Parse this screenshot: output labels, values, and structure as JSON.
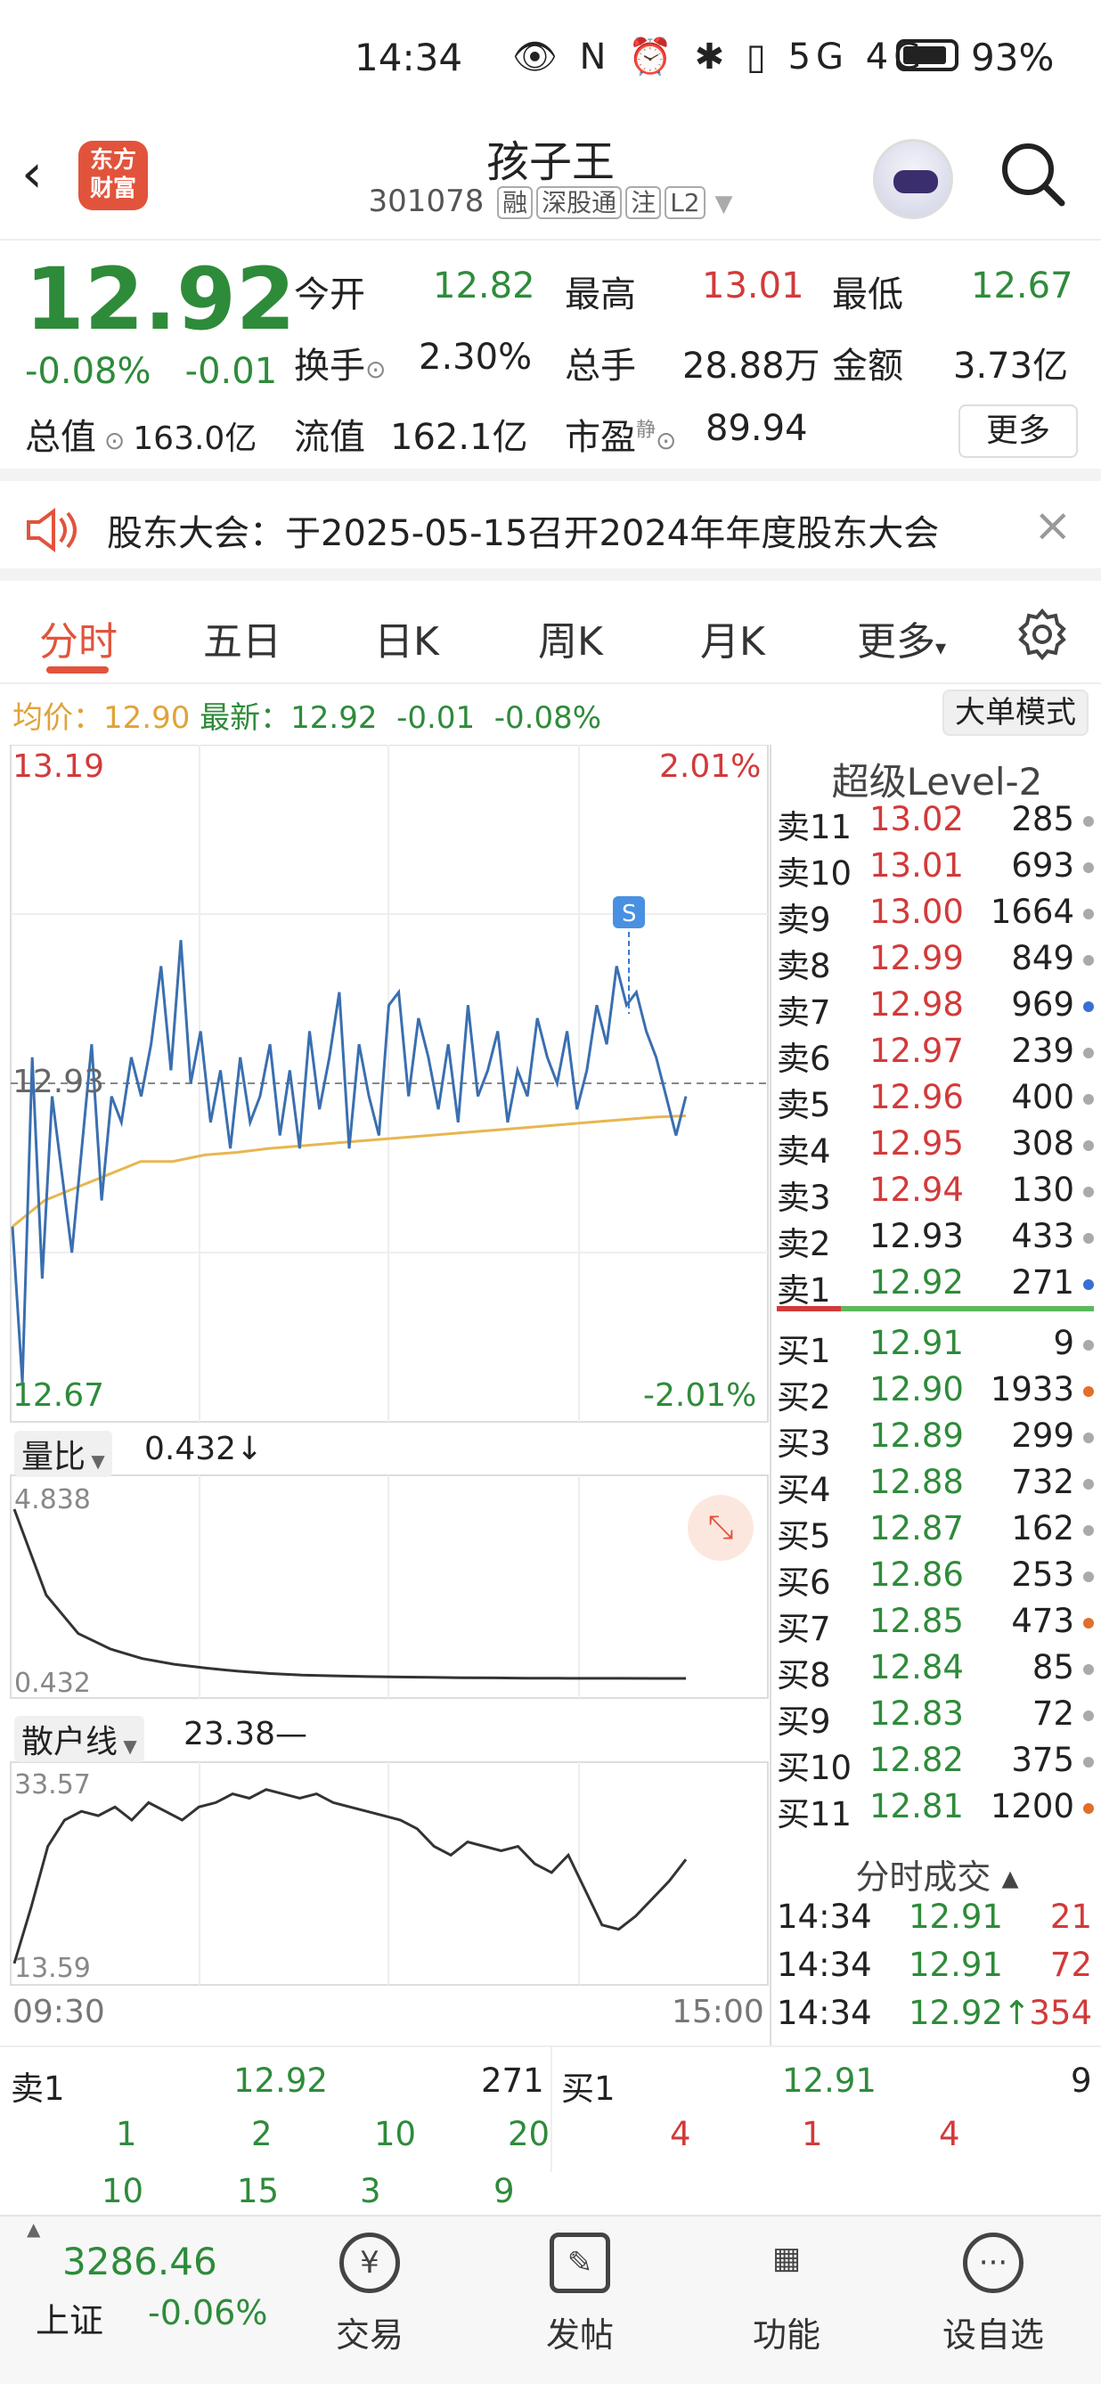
{
  "status_bar": {
    "time": "14:34",
    "icons": "👁 N ⏰ ✱ ▯ 5G 4G",
    "battery": "93%"
  },
  "header": {
    "back_icon": "chevron-left-icon",
    "logo_text": "东方财富",
    "stock_name": "孩子王",
    "stock_code": "301078",
    "tags": [
      "融",
      "深股通",
      "注",
      "L2"
    ]
  },
  "quote": {
    "price": "12.92",
    "change_pct": "-0.08%",
    "change": "-0.01",
    "fields": [
      {
        "label": "今开",
        "value": "12.82",
        "color": "g"
      },
      {
        "label": "最高",
        "value": "13.01",
        "color": "r"
      },
      {
        "label": "最低",
        "value": "12.67",
        "color": "g"
      },
      {
        "label": "换手",
        "value": "2.30%",
        "color": "k"
      },
      {
        "label": "总手",
        "value": "28.88万",
        "color": "k"
      },
      {
        "label": "金额",
        "value": "3.73亿",
        "color": "k"
      },
      {
        "label": "流值",
        "value": "162.1亿",
        "color": "k"
      },
      {
        "label": "市盈",
        "value": "89.94",
        "color": "k"
      }
    ],
    "total_value_label": "总值",
    "total_value": "163.0亿",
    "pe_sup": "静",
    "more_button": "更多"
  },
  "notice": {
    "text": "股东大会：于2025-05-15召开2024年年度股东大会"
  },
  "tabs": [
    "分时",
    "五日",
    "日K",
    "周K",
    "月K",
    "更多"
  ],
  "infobar": {
    "avg_label": "均价：",
    "avg": "12.90",
    "latest_label": "最新：",
    "latest": "12.92",
    "chg": "-0.01",
    "pct": "-0.08%",
    "button": "大单模式"
  },
  "chart_data": [
    {
      "type": "line",
      "title": "",
      "xlabel": "",
      "ylabel": "",
      "x_ticks": [
        "09:30",
        "15:00"
      ],
      "ylim": [
        12.67,
        13.19
      ],
      "ylim_pct": [
        "2.01%",
        "-2.01%"
      ],
      "ref_line": "12.93",
      "series": [
        {
          "name": "",
          "values": [
            12.82,
            12.7,
            12.95,
            12.78,
            12.92,
            12.86,
            12.8,
            12.88,
            12.96,
            12.84,
            12.92,
            12.9,
            12.95,
            12.92,
            12.96,
            13.02,
            12.94,
            13.04,
            12.93,
            12.97,
            12.9,
            12.94,
            12.88,
            12.95,
            12.9,
            12.92,
            12.96,
            12.89,
            12.94,
            12.88,
            12.97,
            12.91,
            12.95,
            13.0,
            12.88,
            12.96,
            12.92,
            12.89,
            12.99,
            13.0,
            12.92,
            12.98,
            12.95,
            12.91,
            12.96,
            12.9,
            12.99,
            12.92,
            12.94,
            12.97,
            12.9,
            12.94,
            12.92,
            12.98,
            12.95,
            12.93,
            12.97,
            12.91,
            12.94,
            12.99,
            12.96,
            13.02,
            12.99,
            13.0,
            12.97,
            12.95,
            12.92,
            12.89,
            12.92
          ]
        },
        {
          "name": "",
          "values": [
            12.82,
            12.84,
            12.85,
            12.86,
            12.87,
            12.87,
            12.875,
            12.877,
            12.88,
            12.882,
            12.884,
            12.886,
            12.888,
            12.89,
            12.892,
            12.894,
            12.896,
            12.898,
            12.9,
            12.902,
            12.904,
            12.905
          ]
        }
      ]
    },
    {
      "type": "line",
      "title": "",
      "xlabel": "",
      "ylabel": "",
      "ylim": [
        0.432,
        4.838
      ],
      "series": [
        {
          "name": "",
          "values": [
            4.838,
            2.6,
            1.6,
            1.2,
            0.95,
            0.8,
            0.7,
            0.62,
            0.56,
            0.52,
            0.5,
            0.48,
            0.47,
            0.46,
            0.45,
            0.445,
            0.44,
            0.437,
            0.435,
            0.434,
            0.433,
            0.432
          ]
        }
      ]
    },
    {
      "type": "line",
      "title": "",
      "xlabel": "",
      "ylabel": "",
      "ylim": [
        13.59,
        33.57
      ],
      "series": [
        {
          "name": "",
          "values": [
            13.6,
            20,
            27,
            30,
            31,
            30.5,
            31.5,
            30,
            32,
            31,
            30,
            31.5,
            32,
            33,
            32.5,
            33.5,
            33,
            32.5,
            33,
            32,
            31.5,
            31,
            30.5,
            30,
            29,
            27,
            26,
            27.5,
            27,
            26.5,
            27,
            25,
            24,
            26,
            22,
            18,
            17.5,
            19,
            21,
            23,
            25.5
          ]
        }
      ]
    }
  ],
  "sub1": {
    "label": "量比",
    "value": "0.432↓",
    "top": "4.838",
    "bottom": "0.432"
  },
  "sub2": {
    "label": "散户线",
    "value": "23.38—",
    "top": "33.57",
    "bottom": "13.59"
  },
  "orderbook": {
    "title": "超级Level-2",
    "asks": [
      {
        "label": "卖11",
        "price": "13.02",
        "vol": "285",
        "c": "r",
        "dot": "#aaa"
      },
      {
        "label": "卖10",
        "price": "13.01",
        "vol": "693",
        "c": "r",
        "dot": "#aaa"
      },
      {
        "label": "卖9",
        "price": "13.00",
        "vol": "1664",
        "c": "r",
        "dot": "#aaa"
      },
      {
        "label": "卖8",
        "price": "12.99",
        "vol": "849",
        "c": "r",
        "dot": "#aaa"
      },
      {
        "label": "卖7",
        "price": "12.98",
        "vol": "969",
        "c": "r",
        "dot": "#3a6fd2"
      },
      {
        "label": "卖6",
        "price": "12.97",
        "vol": "239",
        "c": "r",
        "dot": "#aaa"
      },
      {
        "label": "卖5",
        "price": "12.96",
        "vol": "400",
        "c": "r",
        "dot": "#aaa"
      },
      {
        "label": "卖4",
        "price": "12.95",
        "vol": "308",
        "c": "r",
        "dot": "#aaa"
      },
      {
        "label": "卖3",
        "price": "12.94",
        "vol": "130",
        "c": "r",
        "dot": "#aaa"
      },
      {
        "label": "卖2",
        "price": "12.93",
        "vol": "433",
        "c": "k",
        "dot": "#aaa"
      },
      {
        "label": "卖1",
        "price": "12.92",
        "vol": "271",
        "c": "g",
        "dot": "#3a6fd2"
      }
    ],
    "bids": [
      {
        "label": "买1",
        "price": "12.91",
        "vol": "9",
        "c": "g",
        "dot": "#aaa"
      },
      {
        "label": "买2",
        "price": "12.90",
        "vol": "1933",
        "c": "g",
        "dot": "#e0702a"
      },
      {
        "label": "买3",
        "price": "12.89",
        "vol": "299",
        "c": "g",
        "dot": "#aaa"
      },
      {
        "label": "买4",
        "price": "12.88",
        "vol": "732",
        "c": "g",
        "dot": "#aaa"
      },
      {
        "label": "买5",
        "price": "12.87",
        "vol": "162",
        "c": "g",
        "dot": "#aaa"
      },
      {
        "label": "买6",
        "price": "12.86",
        "vol": "253",
        "c": "g",
        "dot": "#aaa"
      },
      {
        "label": "买7",
        "price": "12.85",
        "vol": "473",
        "c": "g",
        "dot": "#e0702a"
      },
      {
        "label": "买8",
        "price": "12.84",
        "vol": "85",
        "c": "g",
        "dot": "#aaa"
      },
      {
        "label": "买9",
        "price": "12.83",
        "vol": "72",
        "c": "g",
        "dot": "#aaa"
      },
      {
        "label": "买10",
        "price": "12.82",
        "vol": "375",
        "c": "g",
        "dot": "#aaa"
      },
      {
        "label": "买11",
        "price": "12.81",
        "vol": "1200",
        "c": "g",
        "dot": "#e0702a"
      }
    ],
    "trades_title": "分时成交 ▴",
    "trades": [
      {
        "time": "14:34",
        "price": "12.91",
        "vol": "21"
      },
      {
        "time": "14:34",
        "price": "12.91",
        "vol": "72"
      },
      {
        "time": "14:34",
        "price": "12.92↑",
        "vol": "354"
      }
    ]
  },
  "level2": {
    "sell_label": "卖1",
    "sell_price": "12.92",
    "sell_vol": "271",
    "buy_label": "买1",
    "buy_price": "12.91",
    "buy_vol": "9",
    "sell_queue": [
      "1",
      "2",
      "10",
      "20",
      "10",
      "15",
      "3",
      "9"
    ],
    "buy_queue": [
      "4",
      "1",
      "4"
    ]
  },
  "bottom": {
    "index_value": "3286.46",
    "index_name": "上证",
    "index_pct": "-0.06%",
    "items": [
      {
        "icon": "¥",
        "label": "交易"
      },
      {
        "icon": "✎",
        "label": "发帖"
      },
      {
        "icon": "▦",
        "label": "功能"
      },
      {
        "icon": "···",
        "label": "设自选"
      }
    ]
  }
}
